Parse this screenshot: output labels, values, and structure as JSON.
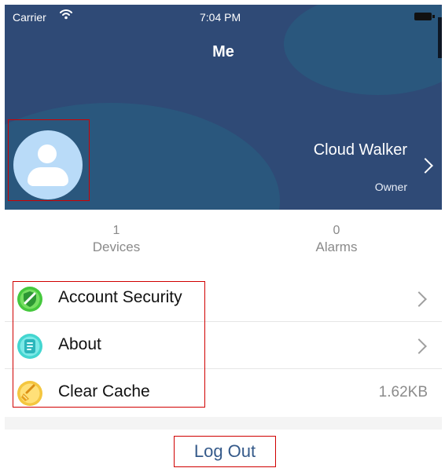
{
  "status_bar": {
    "carrier": "Carrier",
    "time": "7:04 PM",
    "wifi_icon": "wifi-icon",
    "battery_icon": "battery-icon"
  },
  "header": {
    "title": "Me"
  },
  "profile": {
    "name": "Cloud Walker",
    "role": "Owner",
    "avatar_icon": "person-icon",
    "chevron_icon": "chevron-right-icon"
  },
  "stats": {
    "devices": {
      "value": "1",
      "label": "Devices"
    },
    "alarms": {
      "value": "0",
      "label": "Alarms"
    }
  },
  "menu": {
    "items": [
      {
        "label": "Account Security",
        "icon": "shield-icon",
        "value": "",
        "chevron": "chevron-right-icon",
        "accent": "#45c83d"
      },
      {
        "label": "About",
        "icon": "document-icon",
        "value": "",
        "chevron": "chevron-right-icon",
        "accent": "#43d6d0"
      },
      {
        "label": "Clear Cache",
        "icon": "broom-icon",
        "value": "1.62KB",
        "chevron": "",
        "accent": "#f4c63f"
      }
    ]
  },
  "logout": {
    "label": "Log Out"
  },
  "colors": {
    "header_bg": "#2f4a76",
    "header_blob": "#2a577d",
    "avatar_bg": "#b9dbf8",
    "highlight_border": "#d00000",
    "logout_text": "#355a8a"
  }
}
